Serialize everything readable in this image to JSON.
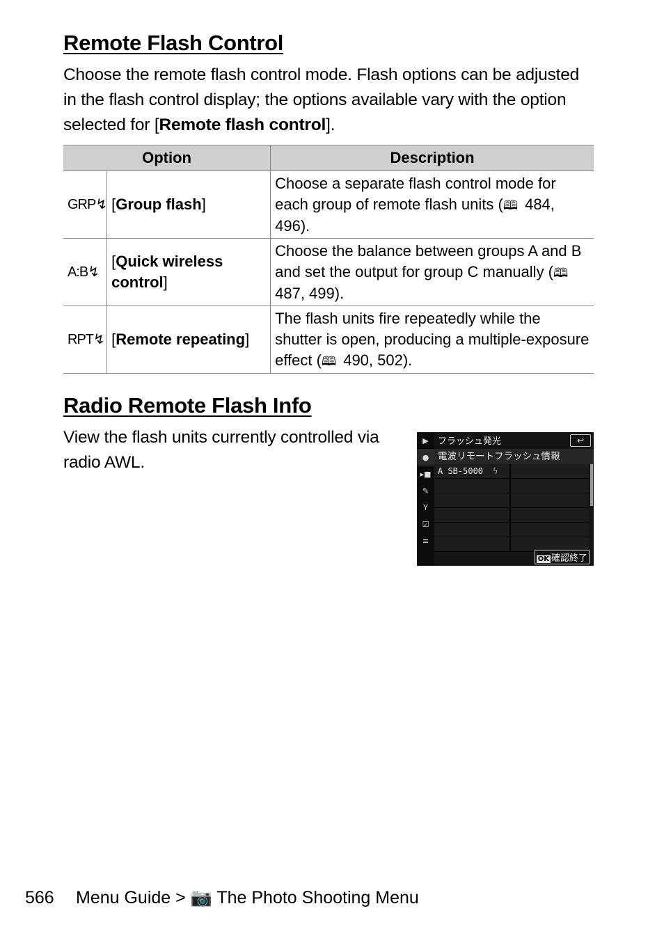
{
  "section1": {
    "title": "Remote Flash Control",
    "intro_pre": "Choose the remote flash control mode. Flash options can be adjusted in the flash control display; the options available vary with the option selected for [",
    "intro_bold": "Remote flash control",
    "intro_post": "].",
    "table": {
      "headers": [
        "Option",
        "Description"
      ],
      "rows": [
        {
          "icon": "GRP↯",
          "icon_name": "group-flash-icon",
          "option": "Group flash",
          "desc": "Choose a separate flash control mode for each group of remote flash units (",
          "refs": "484, 496)."
        },
        {
          "icon": "A:B↯",
          "icon_name": "quick-wireless-icon",
          "option": "Quick wireless control",
          "desc": "Choose the balance between groups A and B and set the output for group C manually (",
          "refs": "487, 499)."
        },
        {
          "icon": "RPT↯",
          "icon_name": "remote-repeating-icon",
          "option": "Remote repeating",
          "desc": "The flash units fire repeatedly while the shutter is open, producing a multiple-exposure effect (",
          "refs": "490, 502)."
        }
      ]
    }
  },
  "section2": {
    "title": "Radio Remote Flash Info",
    "body": "View the flash units currently controlled via radio AWL.",
    "screen": {
      "title": "フラッシュ発光",
      "back_icon": "↩",
      "highlight": "電波リモートフラッシュ情報",
      "unit": "A SB-5000",
      "ok_label": "OK",
      "ok_text": "確認終了"
    }
  },
  "footer": {
    "page_number": "566",
    "breadcrumb_pre": "Menu Guide >",
    "breadcrumb_post": "The Photo Shooting Menu"
  }
}
